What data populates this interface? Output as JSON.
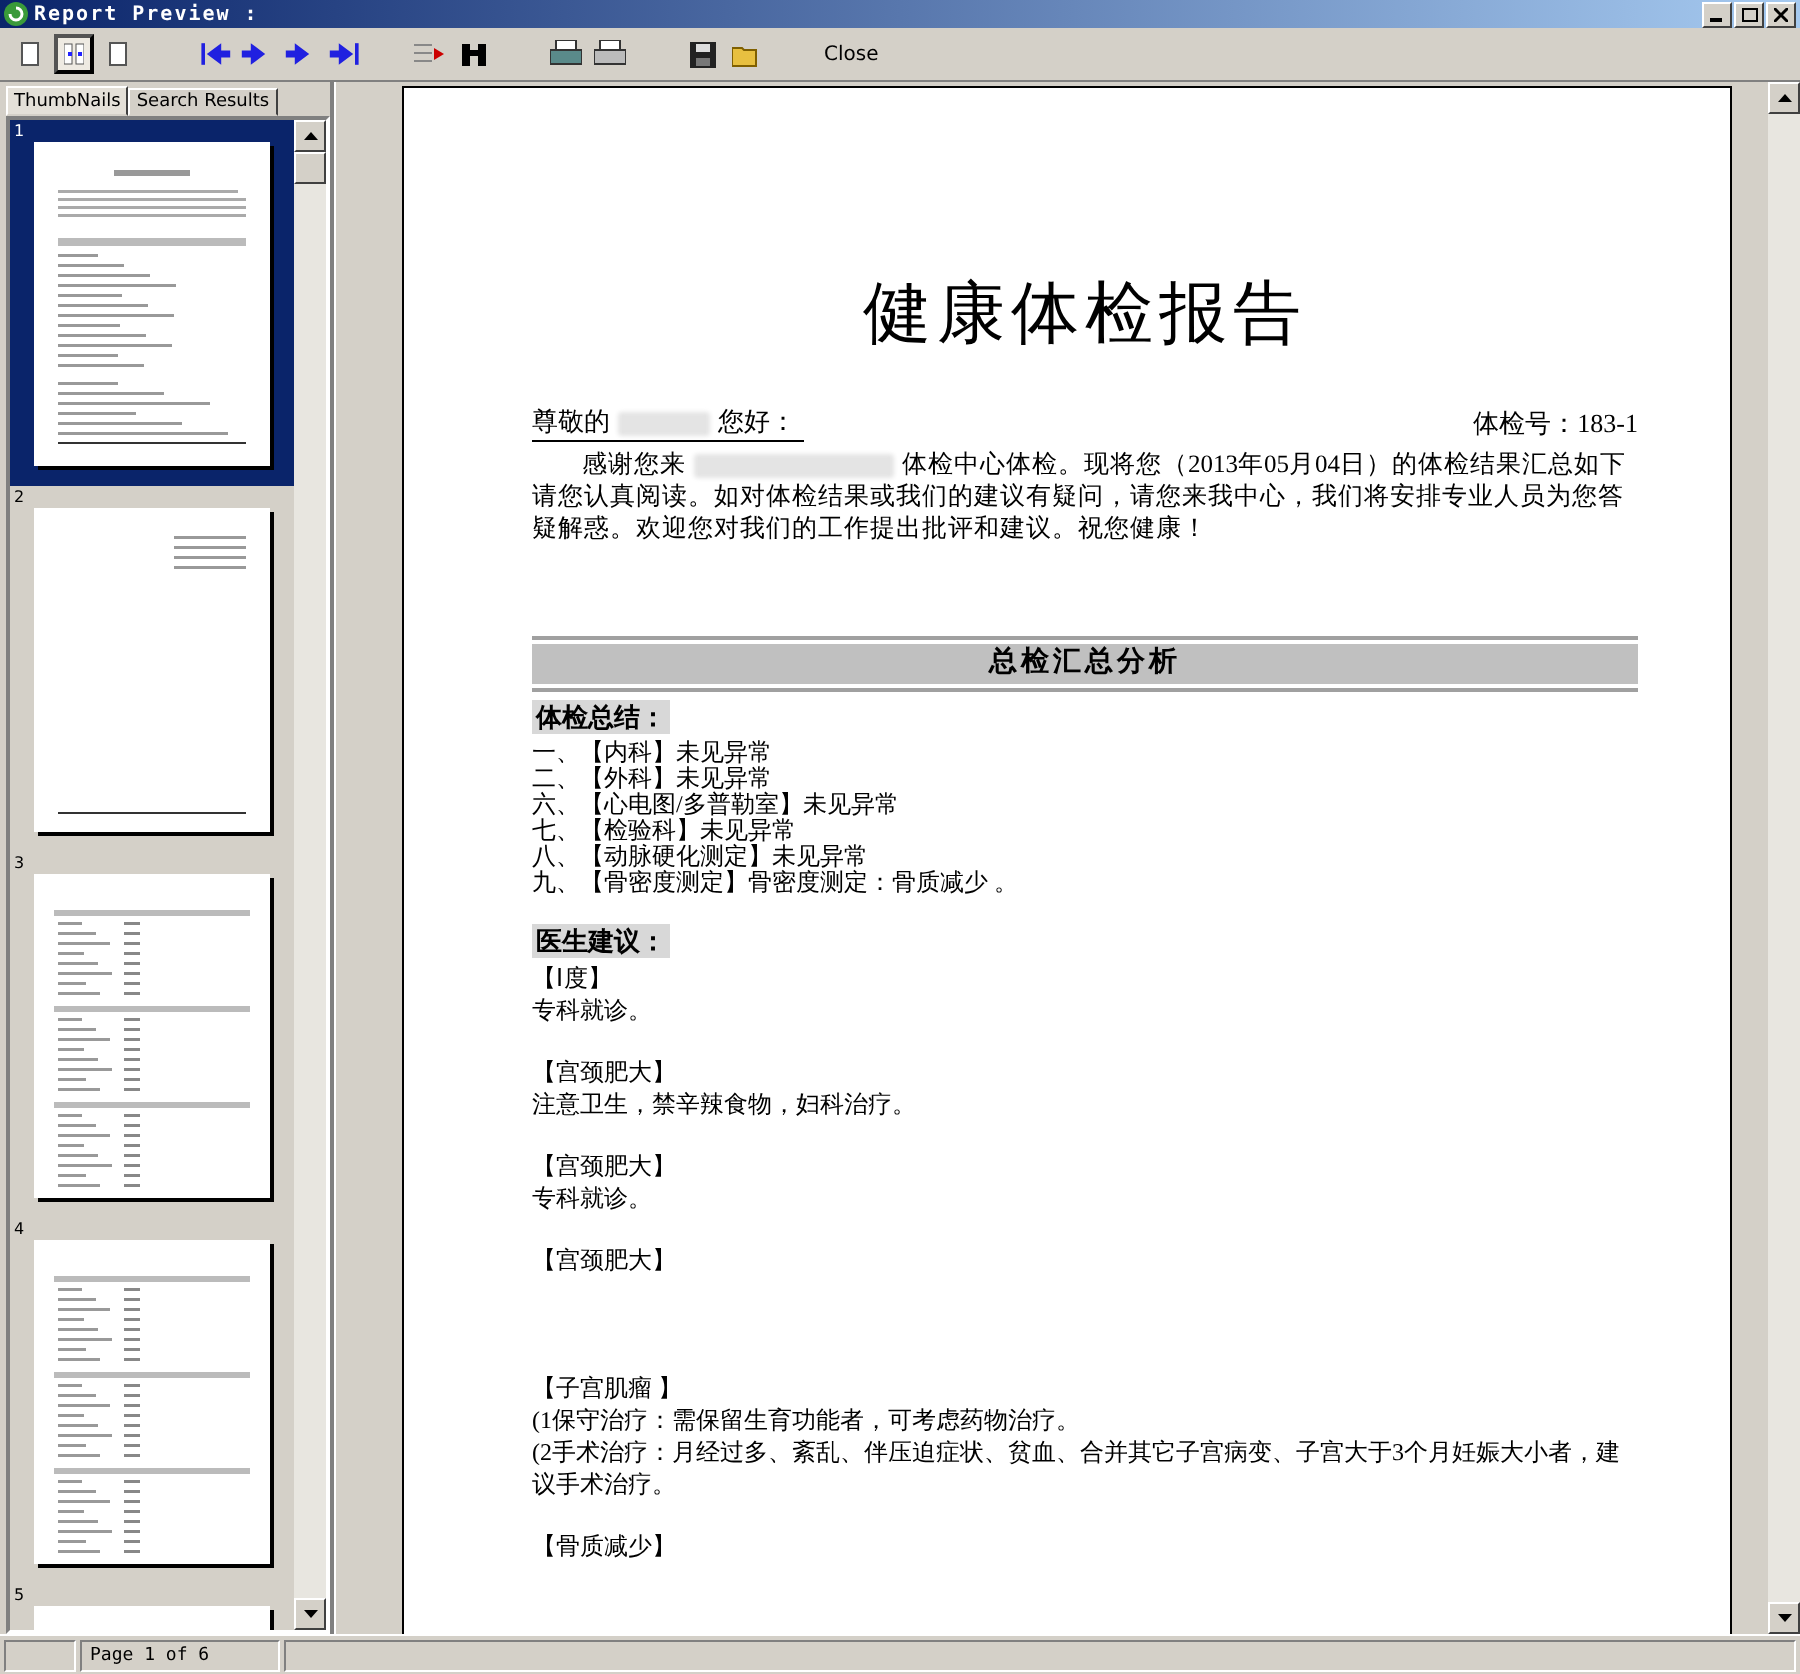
{
  "window": {
    "title": "Report Preview :"
  },
  "toolbar": {
    "view_buttons": [
      {
        "selected": false
      },
      {
        "selected": true
      },
      {
        "selected": false
      }
    ],
    "close_label": "Close"
  },
  "tabs": [
    {
      "label": "ThumbNails",
      "selected": true
    },
    {
      "label": "Search Results",
      "selected": false
    }
  ],
  "thumbnails": [
    {
      "number": "1",
      "selected": true,
      "kind": "cover"
    },
    {
      "number": "2",
      "selected": false,
      "kind": "sparse"
    },
    {
      "number": "3",
      "selected": false,
      "kind": "table"
    },
    {
      "number": "4",
      "selected": false,
      "kind": "table"
    },
    {
      "number": "5",
      "selected": false,
      "kind": "cut"
    }
  ],
  "report": {
    "title": "健康体检报告",
    "greeting_prefix": "尊敬的",
    "greeting_suffix": "您好：",
    "exam_number": "体检号：183-1",
    "intro_before": "感谢您来",
    "intro_after": "体检中心体检。现将您（2013年05月04日）的体检结果汇总如下请您认真阅读。如对体检结果或我们的建议有疑问，请您来我中心，我们将安排专业人员为您答疑解惑。欢迎您对我们的工作提出批评和建议。祝您健康！",
    "section_banner": "总检汇总分析",
    "summary_heading": "体检总结：",
    "summary_items": [
      "一、【内科】未见异常",
      "二、【外科】未见异常",
      "六、【心电图/多普勒室】未见异常",
      "七、【检验科】未见异常",
      "八、【动脉硬化测定】未见异常",
      "九、【骨密度测定】骨密度测定：骨质减少 。"
    ],
    "advice_heading": "医生建议：",
    "advice": [
      {
        "title": "【Ⅰ度】",
        "lines": [
          "专科就诊。"
        ]
      },
      {
        "title": "【宫颈肥大】",
        "lines": [
          "注意卫生，禁辛辣食物，妇科治疗。"
        ]
      },
      {
        "title": "【宫颈肥大】",
        "lines": [
          "专科就诊。"
        ]
      },
      {
        "title": "【宫颈肥大】"
      },
      {
        "title": "【子宫肌瘤  】",
        "lines": [
          "(1保守治疗：需保留生育功能者，可考虑药物治疗。",
          "(2手术治疗：月经过多、紊乱、伴压迫症状、贫血、合并其它子宫病变、子宫大于3个月妊娠大小者，建议手术治疗。"
        ]
      },
      {
        "title": "【骨质减少】"
      }
    ]
  },
  "status_bar": {
    "page_info": "Page 1 of 6"
  }
}
